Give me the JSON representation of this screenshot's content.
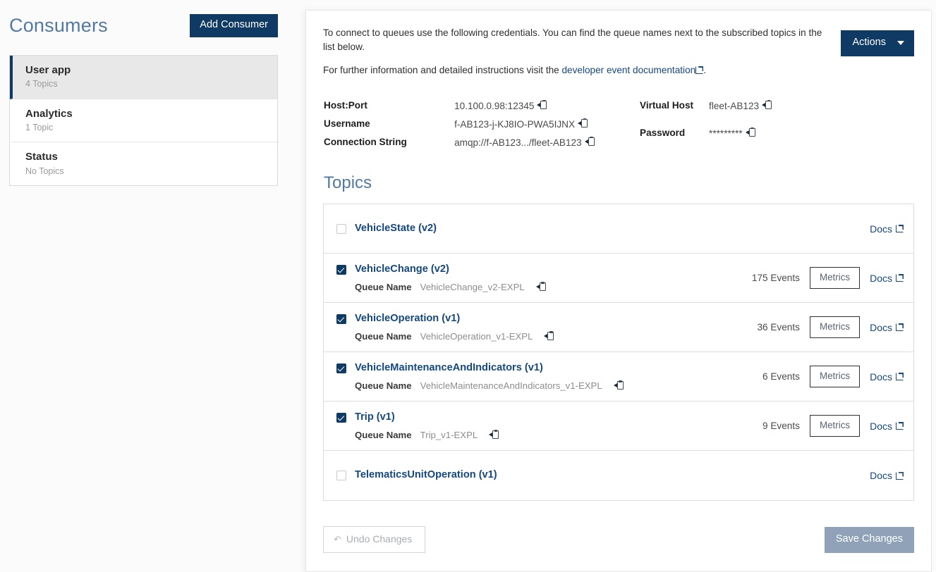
{
  "sidebar": {
    "title": "Consumers",
    "add_button": "Add Consumer",
    "items": [
      {
        "name": "User app",
        "sub": "4 Topics",
        "active": true
      },
      {
        "name": "Analytics",
        "sub": "1 Topic",
        "active": false
      },
      {
        "name": "Status",
        "sub": "No Topics",
        "active": false
      }
    ]
  },
  "panel": {
    "intro_line1": "To connect to queues use the following credentials. You can find the queue names next to the subscribed topics in the list below.",
    "intro_line2_before": "For further information and detailed instructions visit the ",
    "intro_link": "developer event documentation",
    "intro_line2_after": ".",
    "actions_button": "Actions",
    "credentials_left": [
      {
        "label": "Host:Port",
        "value": "10.100.0.98:12345"
      },
      {
        "label": "Username",
        "value": "f-AB123-j-KJ8IO-PWA5IJNX"
      },
      {
        "label": "Connection String",
        "value": "amqp://f-AB123.../fleet-AB123"
      }
    ],
    "credentials_right": [
      {
        "label": "Virtual Host",
        "value": "fleet-AB123"
      },
      {
        "label": "Password",
        "value": "*********"
      }
    ],
    "topics_title": "Topics",
    "queue_name_label": "Queue Name",
    "metrics_label": "Metrics",
    "docs_label": "Docs",
    "topics": [
      {
        "name": "VehicleState (v2)",
        "checked": false,
        "queue_name": "",
        "events": "",
        "has_metrics": false
      },
      {
        "name": "VehicleChange (v2)",
        "checked": true,
        "queue_name": "VehicleChange_v2-EXPL",
        "events": "175 Events",
        "has_metrics": true
      },
      {
        "name": "VehicleOperation (v1)",
        "checked": true,
        "queue_name": "VehicleOperation_v1-EXPL",
        "events": "36 Events",
        "has_metrics": true
      },
      {
        "name": "VehicleMaintenanceAndIndicators (v1)",
        "checked": true,
        "queue_name": "VehicleMaintenanceAndIndicators_v1-EXPL",
        "events": "6 Events",
        "has_metrics": true
      },
      {
        "name": "Trip (v1)",
        "checked": true,
        "queue_name": "Trip_v1-EXPL",
        "events": "9 Events",
        "has_metrics": true
      },
      {
        "name": "TelematicsUnitOperation (v1)",
        "checked": false,
        "queue_name": "",
        "events": "",
        "has_metrics": false
      }
    ],
    "undo_button": "Undo Changes",
    "undo_arrow_glyph": "↶",
    "save_button": "Save Changes"
  },
  "colors": {
    "brand_navy": "#0e3a63",
    "heading_blue": "#5279a3",
    "link_blue": "#14487e",
    "save_disabled": "#8fa2b7"
  }
}
